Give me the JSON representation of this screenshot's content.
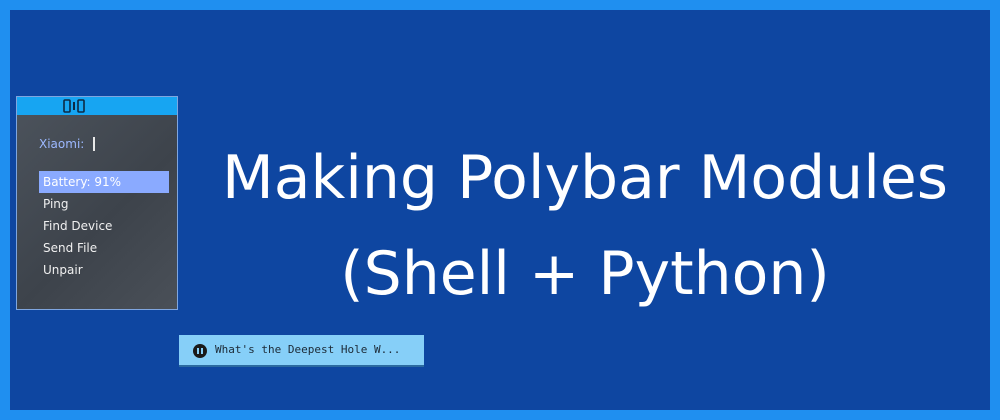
{
  "launcher": {
    "prompt_label": "Xiaomi:",
    "items": [
      {
        "label": "Battery: 91%",
        "selected": true
      },
      {
        "label": "Ping"
      },
      {
        "label": "Find Device"
      },
      {
        "label": "Send File"
      },
      {
        "label": "Unpair"
      }
    ]
  },
  "banner": {
    "title_line1": "Making Polybar Modules",
    "title_line2": "(Shell + Python)"
  },
  "media_player": {
    "now_playing": "What's the Deepest Hole W..."
  },
  "colors": {
    "background_frame": "#1f8ff0",
    "background_main": "#0e46a1",
    "accent_bar": "#17a5f2",
    "selection": "#8aaaff",
    "media_bar": "#86cff8"
  },
  "icons": {
    "panel": "phone-pair-icon",
    "media": "pause-icon"
  }
}
